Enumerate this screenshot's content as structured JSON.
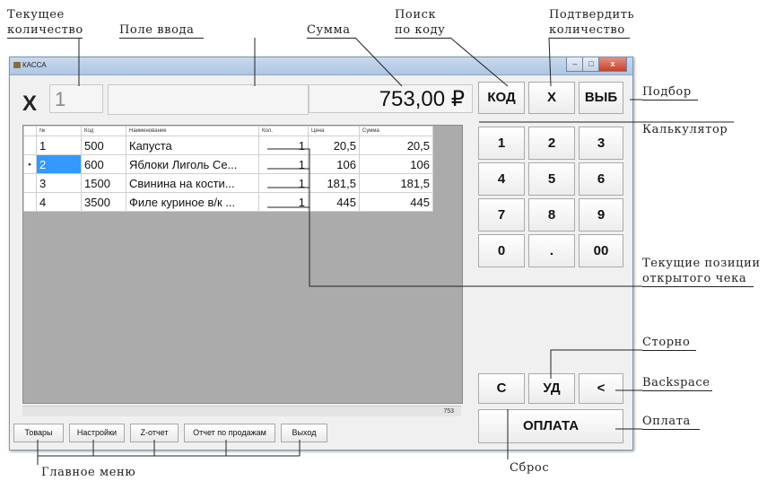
{
  "callouts": {
    "current_qty": "Текущее\nколичество",
    "input_field": "Поле ввода",
    "sum": "Сумма",
    "search_by_code": "Поиск\nпо коду",
    "confirm_qty": "Подтвердить\nколичество",
    "selection": "Подбор",
    "calculator": "Калькулятор",
    "current_items": "Текущие позиции\nоткрытого чека",
    "storno": "Сторно",
    "backspace": "Backspace",
    "payment": "Оплата",
    "reset": "Сброс",
    "main_menu": "Главное меню"
  },
  "window": {
    "title": "КАССА",
    "minimize": "–",
    "maximize": "□",
    "close": "x"
  },
  "top": {
    "qty_symbol": "X",
    "qty_value": "1",
    "input_value": "",
    "sum_value": "753,00 ₽"
  },
  "actions": {
    "code": "КОД",
    "x": "X",
    "select": "ВЫБ"
  },
  "keypad": [
    "1",
    "2",
    "3",
    "4",
    "5",
    "6",
    "7",
    "8",
    "9",
    "0",
    ".",
    "00"
  ],
  "table": {
    "columns": [
      "№",
      "Код",
      "Наименование",
      "Кол.",
      "Цена",
      "Сумма"
    ],
    "rows": [
      {
        "no": "1",
        "code": "500",
        "name": "Капуста",
        "qty": "1",
        "price": "20,5",
        "sum": "20,5"
      },
      {
        "no": "2",
        "code": "600",
        "name": "Яблоки Лиголь Се...",
        "qty": "1",
        "price": "106",
        "sum": "106"
      },
      {
        "no": "3",
        "code": "1500",
        "name": "Свинина на кости...",
        "qty": "1",
        "price": "181,5",
        "sum": "181,5"
      },
      {
        "no": "4",
        "code": "3500",
        "name": "Филе куриное в/к ...",
        "qty": "1",
        "price": "445",
        "sum": "445"
      }
    ],
    "selected_row": 2,
    "total_strip": "753"
  },
  "bottom": {
    "reset": "С",
    "storno": "УД",
    "backspace": "<",
    "pay": "ОПЛАТА"
  },
  "menu": [
    "Товары",
    "Настройки",
    "Z-отчет",
    "Отчет по продажам",
    "Выход"
  ],
  "colors": {
    "selection": "#3399ff",
    "grid_empty": "#ababab",
    "window_bg": "#f0f0f0"
  }
}
